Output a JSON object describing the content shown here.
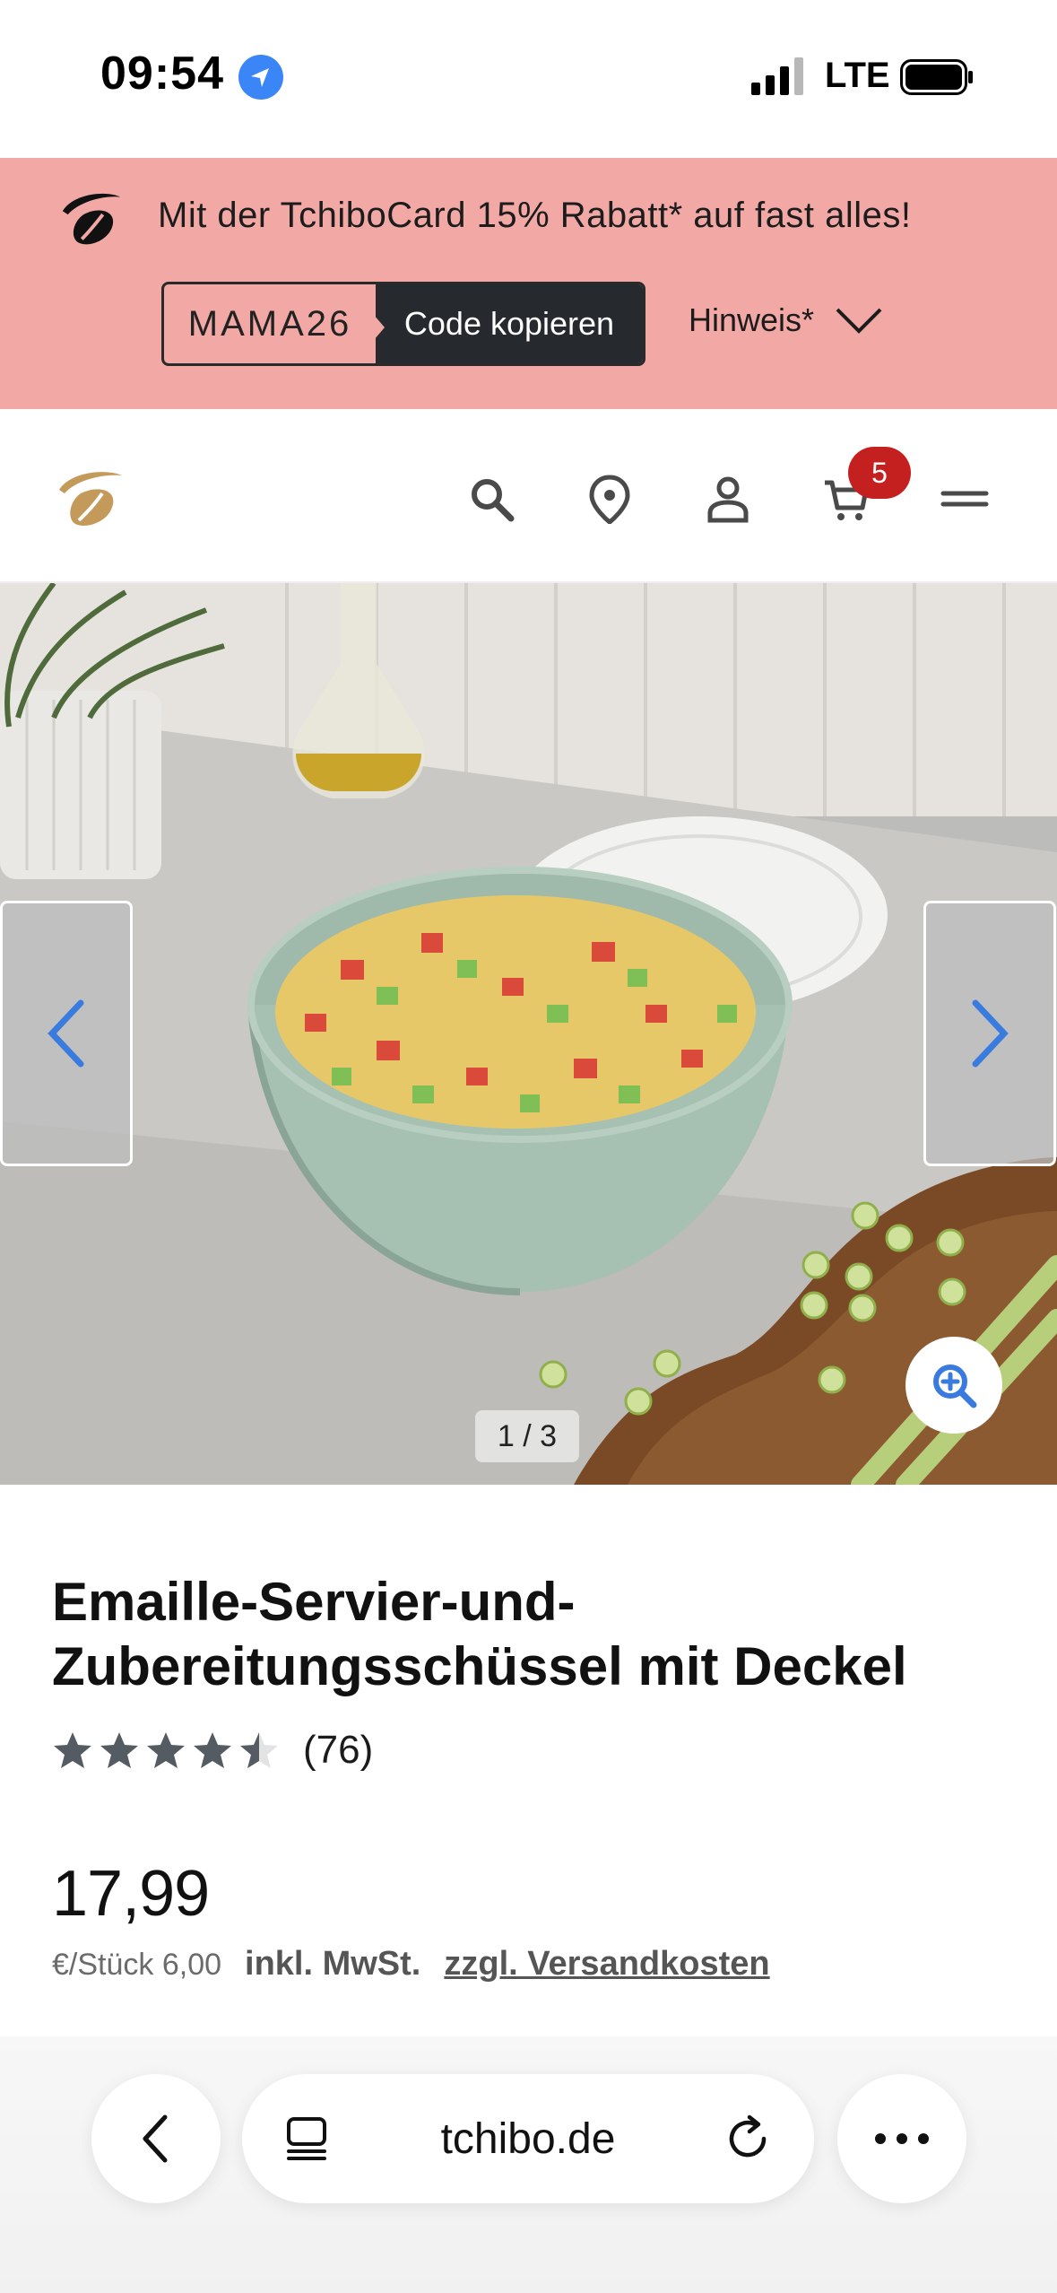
{
  "status_bar": {
    "time": "09:54",
    "network": "LTE",
    "icons": [
      "location-arrow-icon",
      "signal-icon",
      "battery-icon"
    ]
  },
  "promo": {
    "text": "Mit der TchiboCard 15% Rabatt* auf fast alles!",
    "code": "MAMA26",
    "copy_label": "Code kopieren",
    "hint_label": "Hinweis*",
    "background": "#f2a9a6"
  },
  "header": {
    "icons": [
      "tchibo-logo",
      "search-icon",
      "location-pin-icon",
      "user-icon",
      "cart-icon",
      "menu-icon"
    ],
    "cart_count": "5",
    "badge_color": "#c4201f"
  },
  "gallery": {
    "counter": "1 / 3",
    "icons": [
      "chevron-left-icon",
      "chevron-right-icon",
      "zoom-in-icon"
    ],
    "accent": "#3a7be0"
  },
  "product": {
    "title": "Emaille-Servier-und-Zubereitungsschüssel mit Deckel",
    "rating": 4.5,
    "rating_max": 5,
    "review_count": "(76)",
    "price": "17,99",
    "unit_price": "€/Stück 6,00",
    "tax_note": "inkl. MwSt.",
    "shipping_link": "zzgl. Versandkosten"
  },
  "browser": {
    "url": "tchibo.de",
    "icons": [
      "back-icon",
      "tabs-icon",
      "reload-icon",
      "more-icon"
    ]
  }
}
